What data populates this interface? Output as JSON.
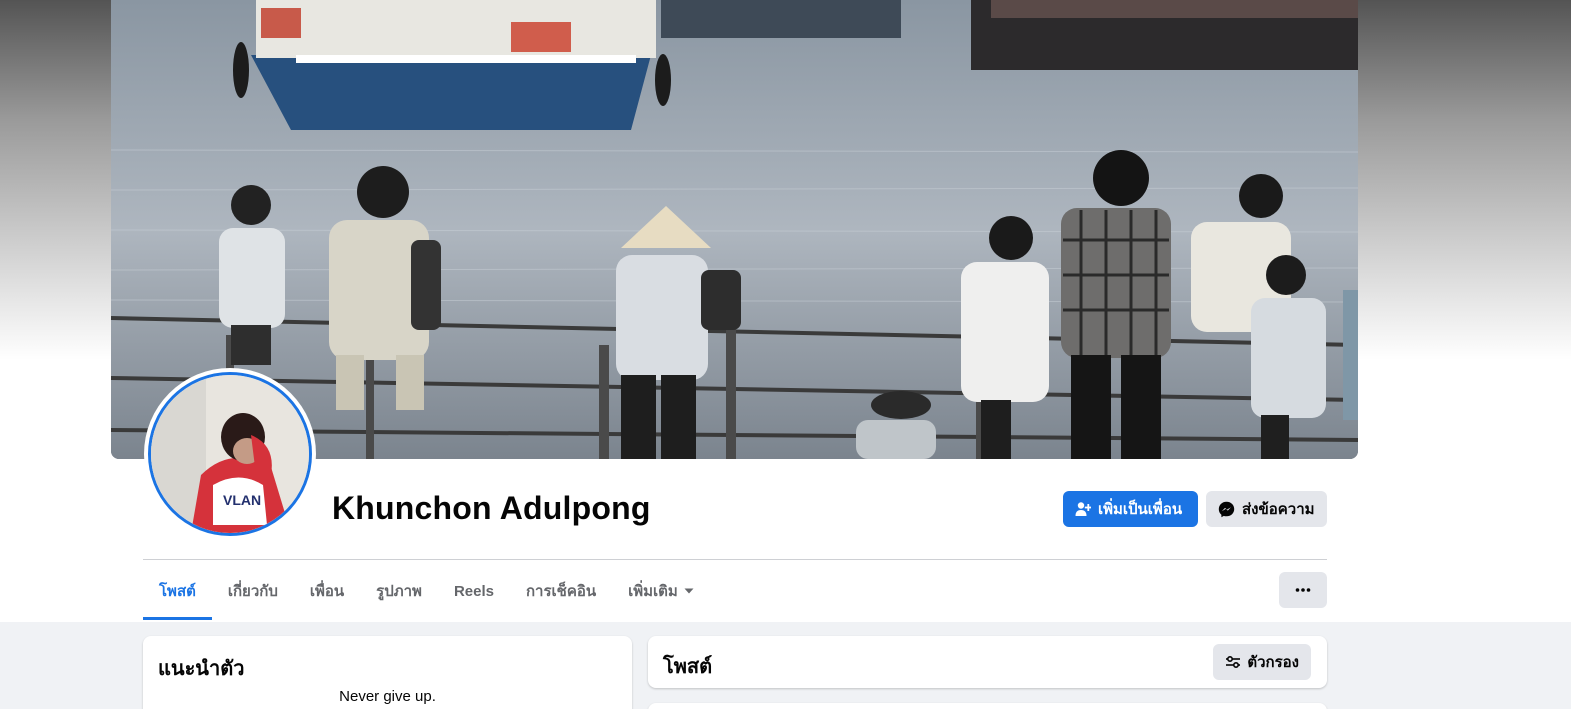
{
  "profile": {
    "name": "Khunchon Adulpong"
  },
  "actions": {
    "add_friend_label": "เพิ่มเป็นเพื่อน",
    "message_label": "ส่งข้อความ"
  },
  "tabs": [
    {
      "label": "โพสต์",
      "active": true
    },
    {
      "label": "เกี่ยวกับ"
    },
    {
      "label": "เพื่อน"
    },
    {
      "label": "รูปภาพ"
    },
    {
      "label": "Reels"
    },
    {
      "label": "การเช็คอิน"
    },
    {
      "label": "เพิ่มเติม"
    }
  ],
  "intro": {
    "title": "แนะนำตัว",
    "bio": "Never give up."
  },
  "posts": {
    "title": "โพสต์",
    "filter_label": "ตัวกรอง"
  },
  "icons": {
    "add_friend": "person-plus-icon",
    "message": "messenger-icon",
    "more_tab": "caret-down-icon",
    "more": "ellipsis-icon",
    "filter": "sliders-icon"
  },
  "colors": {
    "accent": "#1b74e4",
    "background": "#f0f2f5",
    "secondary_button": "#e4e6eb"
  }
}
